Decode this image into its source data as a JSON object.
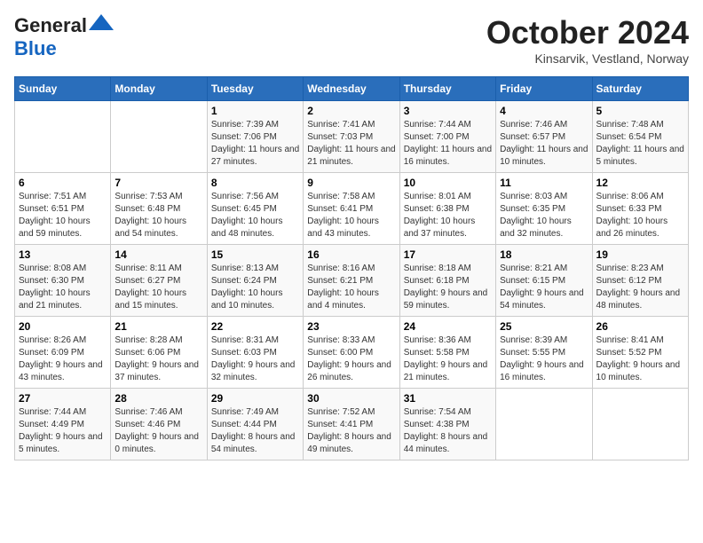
{
  "header": {
    "logo_general": "General",
    "logo_blue": "Blue",
    "month_title": "October 2024",
    "location": "Kinsarvik, Vestland, Norway"
  },
  "days_of_week": [
    "Sunday",
    "Monday",
    "Tuesday",
    "Wednesday",
    "Thursday",
    "Friday",
    "Saturday"
  ],
  "weeks": [
    [
      {
        "day": "",
        "info": ""
      },
      {
        "day": "",
        "info": ""
      },
      {
        "day": "1",
        "sunrise": "Sunrise: 7:39 AM",
        "sunset": "Sunset: 7:06 PM",
        "daylight": "Daylight: 11 hours and 27 minutes."
      },
      {
        "day": "2",
        "sunrise": "Sunrise: 7:41 AM",
        "sunset": "Sunset: 7:03 PM",
        "daylight": "Daylight: 11 hours and 21 minutes."
      },
      {
        "day": "3",
        "sunrise": "Sunrise: 7:44 AM",
        "sunset": "Sunset: 7:00 PM",
        "daylight": "Daylight: 11 hours and 16 minutes."
      },
      {
        "day": "4",
        "sunrise": "Sunrise: 7:46 AM",
        "sunset": "Sunset: 6:57 PM",
        "daylight": "Daylight: 11 hours and 10 minutes."
      },
      {
        "day": "5",
        "sunrise": "Sunrise: 7:48 AM",
        "sunset": "Sunset: 6:54 PM",
        "daylight": "Daylight: 11 hours and 5 minutes."
      }
    ],
    [
      {
        "day": "6",
        "sunrise": "Sunrise: 7:51 AM",
        "sunset": "Sunset: 6:51 PM",
        "daylight": "Daylight: 10 hours and 59 minutes."
      },
      {
        "day": "7",
        "sunrise": "Sunrise: 7:53 AM",
        "sunset": "Sunset: 6:48 PM",
        "daylight": "Daylight: 10 hours and 54 minutes."
      },
      {
        "day": "8",
        "sunrise": "Sunrise: 7:56 AM",
        "sunset": "Sunset: 6:45 PM",
        "daylight": "Daylight: 10 hours and 48 minutes."
      },
      {
        "day": "9",
        "sunrise": "Sunrise: 7:58 AM",
        "sunset": "Sunset: 6:41 PM",
        "daylight": "Daylight: 10 hours and 43 minutes."
      },
      {
        "day": "10",
        "sunrise": "Sunrise: 8:01 AM",
        "sunset": "Sunset: 6:38 PM",
        "daylight": "Daylight: 10 hours and 37 minutes."
      },
      {
        "day": "11",
        "sunrise": "Sunrise: 8:03 AM",
        "sunset": "Sunset: 6:35 PM",
        "daylight": "Daylight: 10 hours and 32 minutes."
      },
      {
        "day": "12",
        "sunrise": "Sunrise: 8:06 AM",
        "sunset": "Sunset: 6:33 PM",
        "daylight": "Daylight: 10 hours and 26 minutes."
      }
    ],
    [
      {
        "day": "13",
        "sunrise": "Sunrise: 8:08 AM",
        "sunset": "Sunset: 6:30 PM",
        "daylight": "Daylight: 10 hours and 21 minutes."
      },
      {
        "day": "14",
        "sunrise": "Sunrise: 8:11 AM",
        "sunset": "Sunset: 6:27 PM",
        "daylight": "Daylight: 10 hours and 15 minutes."
      },
      {
        "day": "15",
        "sunrise": "Sunrise: 8:13 AM",
        "sunset": "Sunset: 6:24 PM",
        "daylight": "Daylight: 10 hours and 10 minutes."
      },
      {
        "day": "16",
        "sunrise": "Sunrise: 8:16 AM",
        "sunset": "Sunset: 6:21 PM",
        "daylight": "Daylight: 10 hours and 4 minutes."
      },
      {
        "day": "17",
        "sunrise": "Sunrise: 8:18 AM",
        "sunset": "Sunset: 6:18 PM",
        "daylight": "Daylight: 9 hours and 59 minutes."
      },
      {
        "day": "18",
        "sunrise": "Sunrise: 8:21 AM",
        "sunset": "Sunset: 6:15 PM",
        "daylight": "Daylight: 9 hours and 54 minutes."
      },
      {
        "day": "19",
        "sunrise": "Sunrise: 8:23 AM",
        "sunset": "Sunset: 6:12 PM",
        "daylight": "Daylight: 9 hours and 48 minutes."
      }
    ],
    [
      {
        "day": "20",
        "sunrise": "Sunrise: 8:26 AM",
        "sunset": "Sunset: 6:09 PM",
        "daylight": "Daylight: 9 hours and 43 minutes."
      },
      {
        "day": "21",
        "sunrise": "Sunrise: 8:28 AM",
        "sunset": "Sunset: 6:06 PM",
        "daylight": "Daylight: 9 hours and 37 minutes."
      },
      {
        "day": "22",
        "sunrise": "Sunrise: 8:31 AM",
        "sunset": "Sunset: 6:03 PM",
        "daylight": "Daylight: 9 hours and 32 minutes."
      },
      {
        "day": "23",
        "sunrise": "Sunrise: 8:33 AM",
        "sunset": "Sunset: 6:00 PM",
        "daylight": "Daylight: 9 hours and 26 minutes."
      },
      {
        "day": "24",
        "sunrise": "Sunrise: 8:36 AM",
        "sunset": "Sunset: 5:58 PM",
        "daylight": "Daylight: 9 hours and 21 minutes."
      },
      {
        "day": "25",
        "sunrise": "Sunrise: 8:39 AM",
        "sunset": "Sunset: 5:55 PM",
        "daylight": "Daylight: 9 hours and 16 minutes."
      },
      {
        "day": "26",
        "sunrise": "Sunrise: 8:41 AM",
        "sunset": "Sunset: 5:52 PM",
        "daylight": "Daylight: 9 hours and 10 minutes."
      }
    ],
    [
      {
        "day": "27",
        "sunrise": "Sunrise: 7:44 AM",
        "sunset": "Sunset: 4:49 PM",
        "daylight": "Daylight: 9 hours and 5 minutes."
      },
      {
        "day": "28",
        "sunrise": "Sunrise: 7:46 AM",
        "sunset": "Sunset: 4:46 PM",
        "daylight": "Daylight: 9 hours and 0 minutes."
      },
      {
        "day": "29",
        "sunrise": "Sunrise: 7:49 AM",
        "sunset": "Sunset: 4:44 PM",
        "daylight": "Daylight: 8 hours and 54 minutes."
      },
      {
        "day": "30",
        "sunrise": "Sunrise: 7:52 AM",
        "sunset": "Sunset: 4:41 PM",
        "daylight": "Daylight: 8 hours and 49 minutes."
      },
      {
        "day": "31",
        "sunrise": "Sunrise: 7:54 AM",
        "sunset": "Sunset: 4:38 PM",
        "daylight": "Daylight: 8 hours and 44 minutes."
      },
      {
        "day": "",
        "info": ""
      },
      {
        "day": "",
        "info": ""
      }
    ]
  ]
}
